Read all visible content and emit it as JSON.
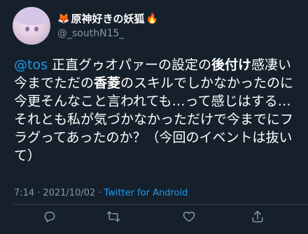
{
  "user": {
    "display_name": "原神好きの妖狐",
    "handle": "@_southN15_",
    "fox_icon_left": "fox-emoji",
    "fox_icon_right": "fire-emoji"
  },
  "tweet": {
    "mention": "@tos",
    "segments": [
      {
        "text": " 正直グゥオパァーの設定の",
        "bold": false
      },
      {
        "text": "後付け",
        "bold": true
      },
      {
        "text": "感凄い  今までただの",
        "bold": false
      },
      {
        "text": "香菱",
        "bold": true
      },
      {
        "text": "のスキルでしかなかったのに今更そんなこと言われても…って感じはする…それとも私が気づかなかっただけで今までにフラグってあったのか？（今回のイベントは抜いて）",
        "bold": false
      }
    ]
  },
  "meta": {
    "time": "7:14",
    "separator": "·",
    "date": "2021/10/02",
    "separator2": "·",
    "source": "Twitter for Android"
  },
  "actions": {
    "reply": "reply-icon",
    "retweet": "retweet-icon",
    "like": "heart-icon",
    "share": "share-icon"
  },
  "colors": {
    "background": "#15202b",
    "accent": "#1d9bf0",
    "muted": "#8899a6"
  }
}
